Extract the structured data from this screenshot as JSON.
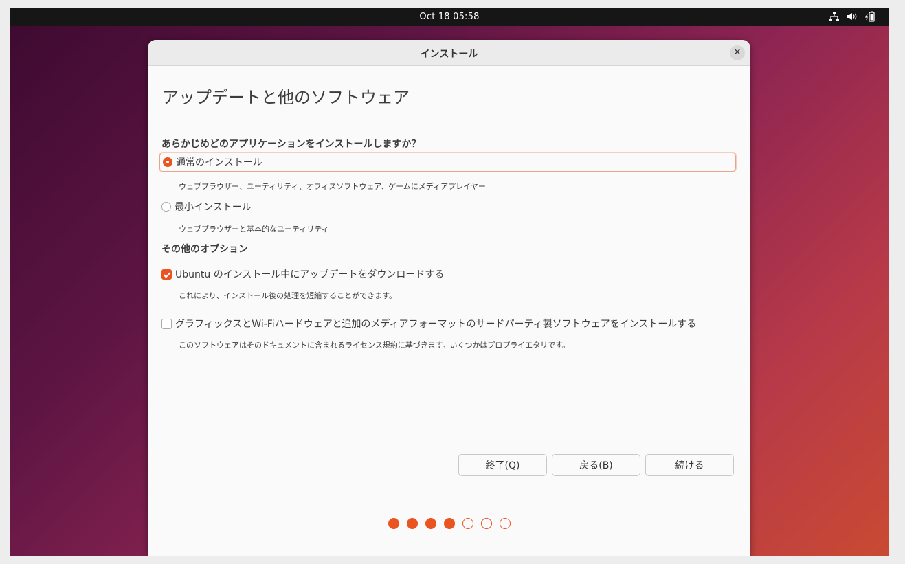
{
  "topbar": {
    "clock": "Oct 18  05:58",
    "icons": [
      "network-icon",
      "volume-icon",
      "battery-icon"
    ]
  },
  "window": {
    "title": "インストール",
    "close_label": "✕",
    "heading": "アップデートと他のソフトウェア"
  },
  "install_type": {
    "question": "あらかじめどのアプリケーションをインストールしますか？",
    "options": [
      {
        "label": "通常のインストール",
        "description": "ウェブブラウザー、ユーティリティ、オフィスソフトウェア、ゲームにメディアプレイヤー",
        "selected": true
      },
      {
        "label": "最小インストール",
        "description": "ウェブブラウザーと基本的なユーティリティ",
        "selected": false
      }
    ]
  },
  "other_options": {
    "title": "その他のオプション",
    "items": [
      {
        "label": "Ubuntu のインストール中にアップデートをダウンロードする",
        "description": "これにより、インストール後の処理を短縮することができます。",
        "checked": true
      },
      {
        "label": "グラフィックスとWi-Fiハードウェアと追加のメディアフォーマットのサードパーティ製ソフトウェアをインストールする",
        "description": "このソフトウェアはそのドキュメントに含まれるライセンス規約に基づきます。いくつかはプロプライエタリです。",
        "checked": false
      }
    ]
  },
  "buttons": {
    "quit": "終了(Q)",
    "back": "戻る(B)",
    "continue": "続ける"
  },
  "progress": {
    "current_step": 4,
    "total_steps": 7
  },
  "colors": {
    "accent": "#e95420",
    "topbar": "#161616"
  }
}
